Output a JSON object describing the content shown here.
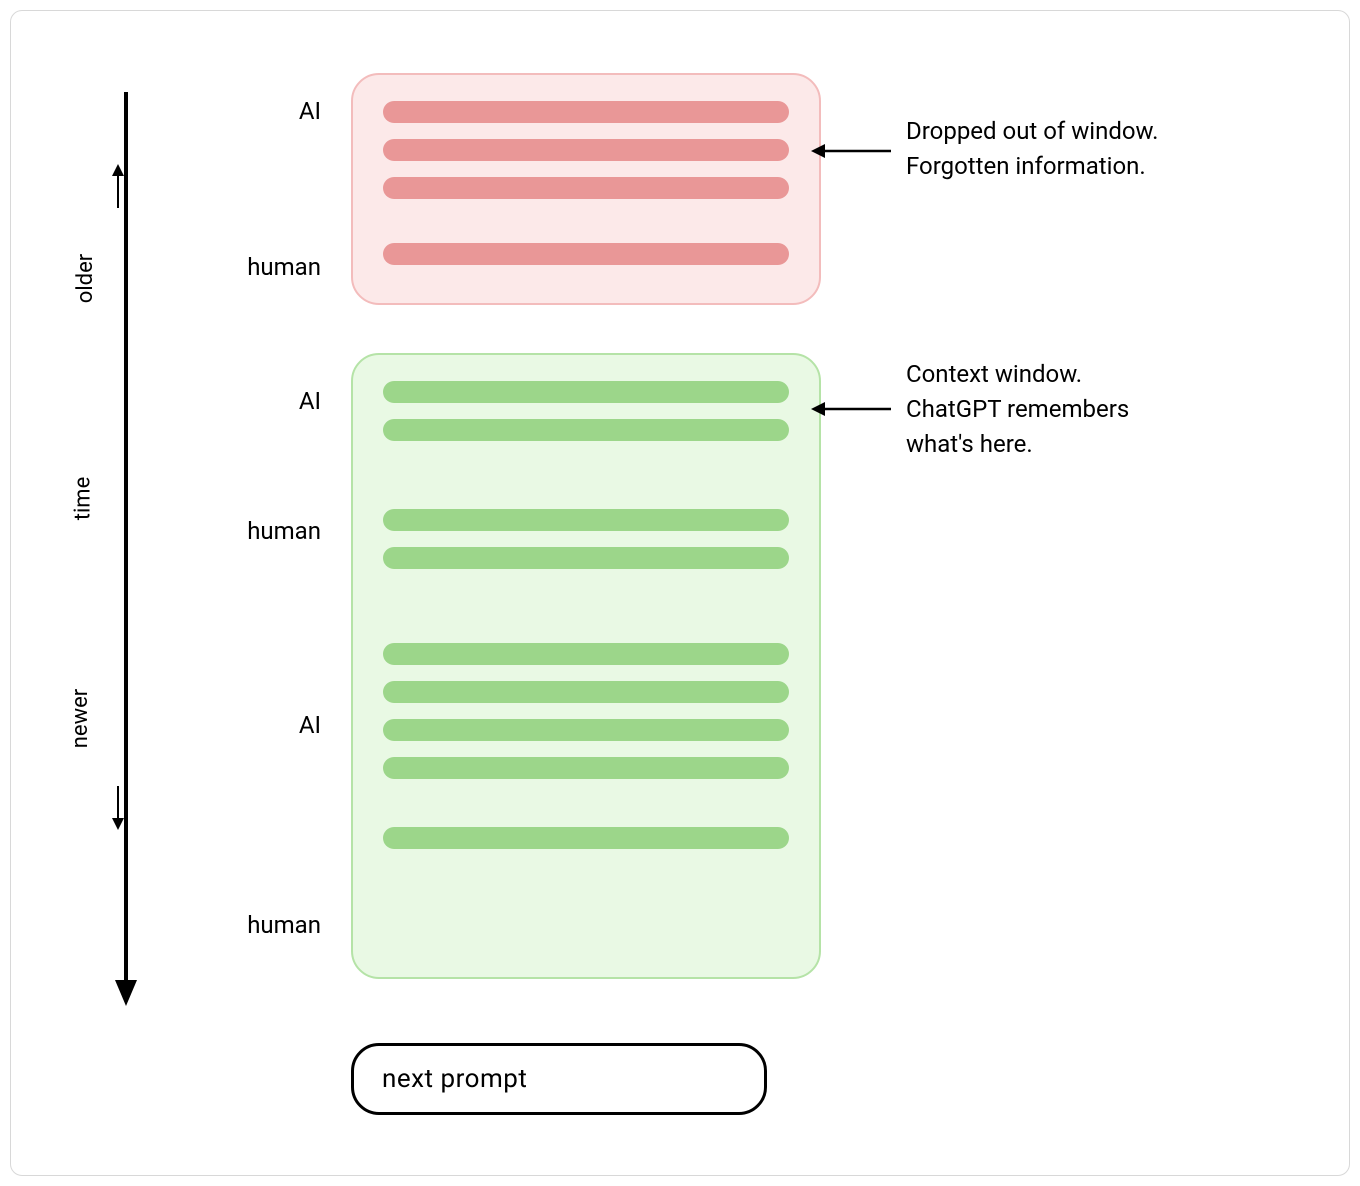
{
  "timeline": {
    "older": "older",
    "time": "time",
    "newer": "newer"
  },
  "roles": {
    "ai": "AI",
    "human": "human"
  },
  "annotations": {
    "dropped": "Dropped out of window.\nForgotten information.",
    "context": "Context window.\nChatGPT remembers\nwhat's here."
  },
  "next_prompt": "next prompt",
  "panels": {
    "forgotten": {
      "color": "red",
      "groups": [
        {
          "role": "ai",
          "bars": 3
        },
        {
          "role": "human",
          "bars": 1
        }
      ]
    },
    "remembered": {
      "color": "green",
      "groups": [
        {
          "role": "ai",
          "bars": 2
        },
        {
          "role": "human",
          "bars": 2
        },
        {
          "role": "ai",
          "bars": 4
        },
        {
          "role": "human",
          "bars": 1
        }
      ]
    }
  },
  "colors": {
    "red_bg": "#fce9e9",
    "red_border": "#f3bcbc",
    "red_bar": "#e99797",
    "green_bg": "#e9f9e4",
    "green_border": "#b5e3a7",
    "green_bar": "#9cd68a"
  }
}
